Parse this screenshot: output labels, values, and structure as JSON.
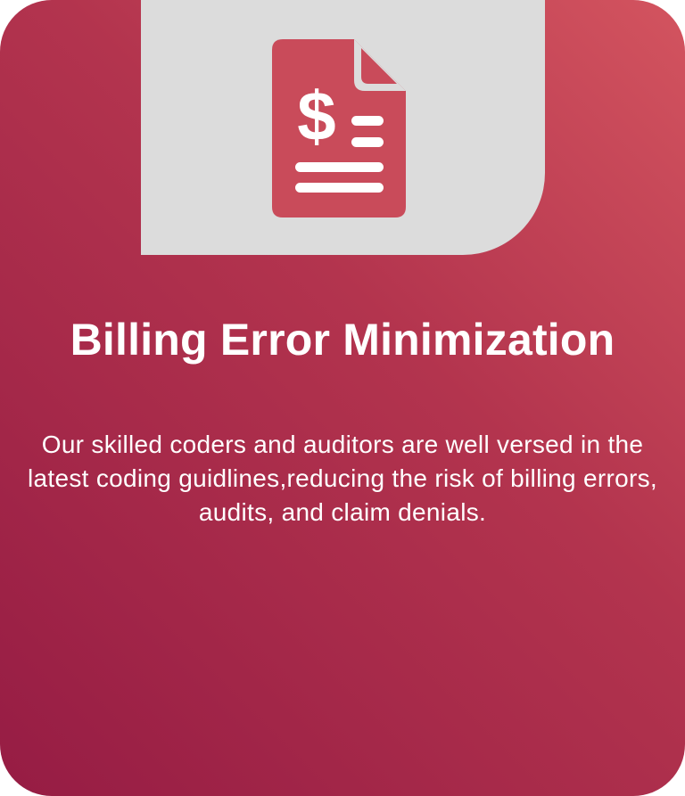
{
  "card": {
    "title": "Billing Error Minimization",
    "description": "Our skilled coders and auditors are well versed in the latest coding guidlines,reducing the risk of billing errors, audits, and claim denials.",
    "icon": "billing-document-icon",
    "icon_glyph": "$"
  },
  "colors": {
    "gradient_light": "#d3545f",
    "gradient_dark": "#961c44",
    "icon_panel": "#dcdcdc",
    "icon_color": "#c94b5a",
    "text": "#ffffff"
  }
}
